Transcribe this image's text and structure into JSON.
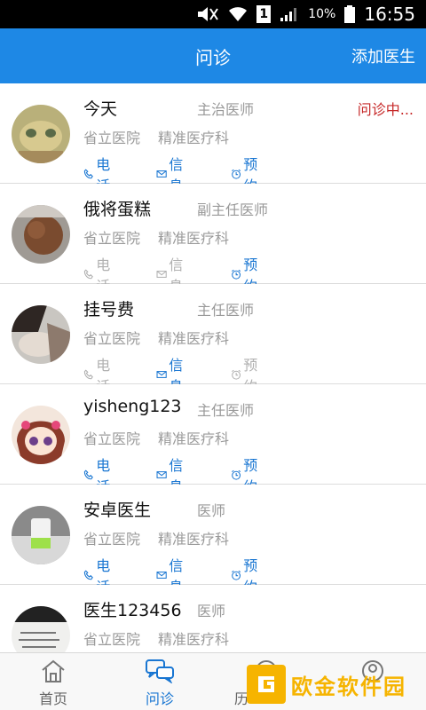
{
  "status_bar": {
    "battery_percent": "10%",
    "time": "16:55",
    "sim_label": "1"
  },
  "app_bar": {
    "title": "问诊",
    "action": "添加医生"
  },
  "doctors": [
    {
      "name": "今天",
      "title": "主治医师",
      "hospital": "省立医院",
      "department": "精准医疗科",
      "status": "问诊中...",
      "actions": {
        "phone": "电话",
        "message": "信息",
        "appointment": "预约"
      }
    },
    {
      "name": "俄将蛋糕",
      "title": "副主任医师",
      "hospital": "省立医院",
      "department": "精准医疗科",
      "actions": {
        "phone": "电话",
        "message": "信息",
        "appointment": "预约"
      }
    },
    {
      "name": "挂号费",
      "title": "主任医师",
      "hospital": "省立医院",
      "department": "精准医疗科",
      "actions": {
        "phone": "电话",
        "message": "信息",
        "appointment": "预约"
      }
    },
    {
      "name": "yisheng123",
      "title": "主任医师",
      "hospital": "省立医院",
      "department": "精准医疗科",
      "actions": {
        "phone": "电话",
        "message": "信息",
        "appointment": "预约"
      }
    },
    {
      "name": "安卓医生",
      "title": "医师",
      "hospital": "省立医院",
      "department": "精准医疗科",
      "actions": {
        "phone": "电话",
        "message": "信息",
        "appointment": "预约"
      }
    },
    {
      "name": "医生123456",
      "title": "医师",
      "hospital": "省立医院",
      "department": "精准医疗科"
    }
  ],
  "bottom_nav": [
    {
      "label": "首页",
      "icon": "home-icon"
    },
    {
      "label": "问诊",
      "icon": "chat-icon",
      "active": true
    },
    {
      "label": "历",
      "icon": "history-icon"
    },
    {
      "label": "",
      "icon": "profile-icon"
    }
  ],
  "watermark": {
    "text": "欧金软件园"
  },
  "colors": {
    "primary": "#1e88e5",
    "link": "#1976d2",
    "status_red": "#c62828",
    "disabled": "#b0b0b0",
    "watermark": "#f6b400"
  }
}
